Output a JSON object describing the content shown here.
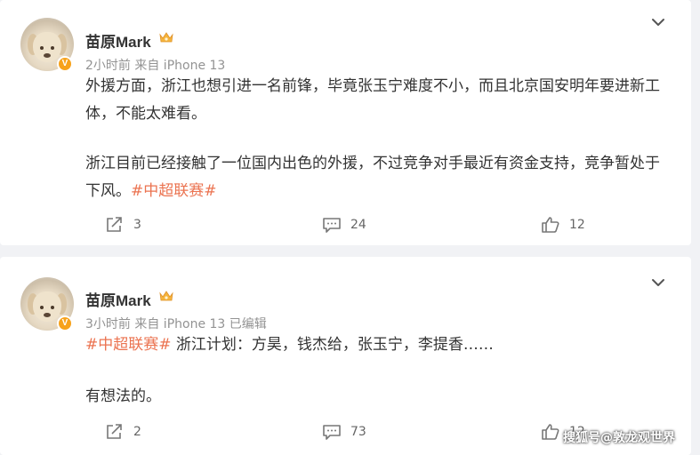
{
  "posts": [
    {
      "username": "苗原Mark",
      "meta": "2小时前 来自 iPhone 13",
      "paragraph1": "外援方面，浙江也想引进一名前锋，毕竟张玉宁难度不小，而且北京国安明年要进新工体，不能太难看。",
      "paragraph2_prefix": "浙江目前已经接触了一位国内出色的外援，不过竞争对手最近有资金支持，竞争暂处于下风。",
      "paragraph2_hashtag": "#中超联赛#",
      "reposts": "3",
      "comments": "24",
      "likes": "12"
    },
    {
      "username": "苗原Mark",
      "meta": "3小时前 来自 iPhone 13 已编辑",
      "line1_hashtag": "#中超联赛#",
      "line1_text": " 浙江计划：方昊，钱杰给，张玉宁，李提香……",
      "line2": "有想法的。",
      "reposts": "2",
      "comments": "73",
      "likes": "12"
    }
  ],
  "icons": {
    "verified_badge": "V",
    "crown": "crown-icon",
    "more": "chevron-down-icon",
    "repost": "repost-icon",
    "comment": "comment-icon",
    "like": "thumbs-up-icon"
  },
  "colors": {
    "hashtag": "#eb7350",
    "badge": "#f7a21b",
    "meta_text": "#939393"
  },
  "watermark": "搜狐号@敦龙观世界"
}
